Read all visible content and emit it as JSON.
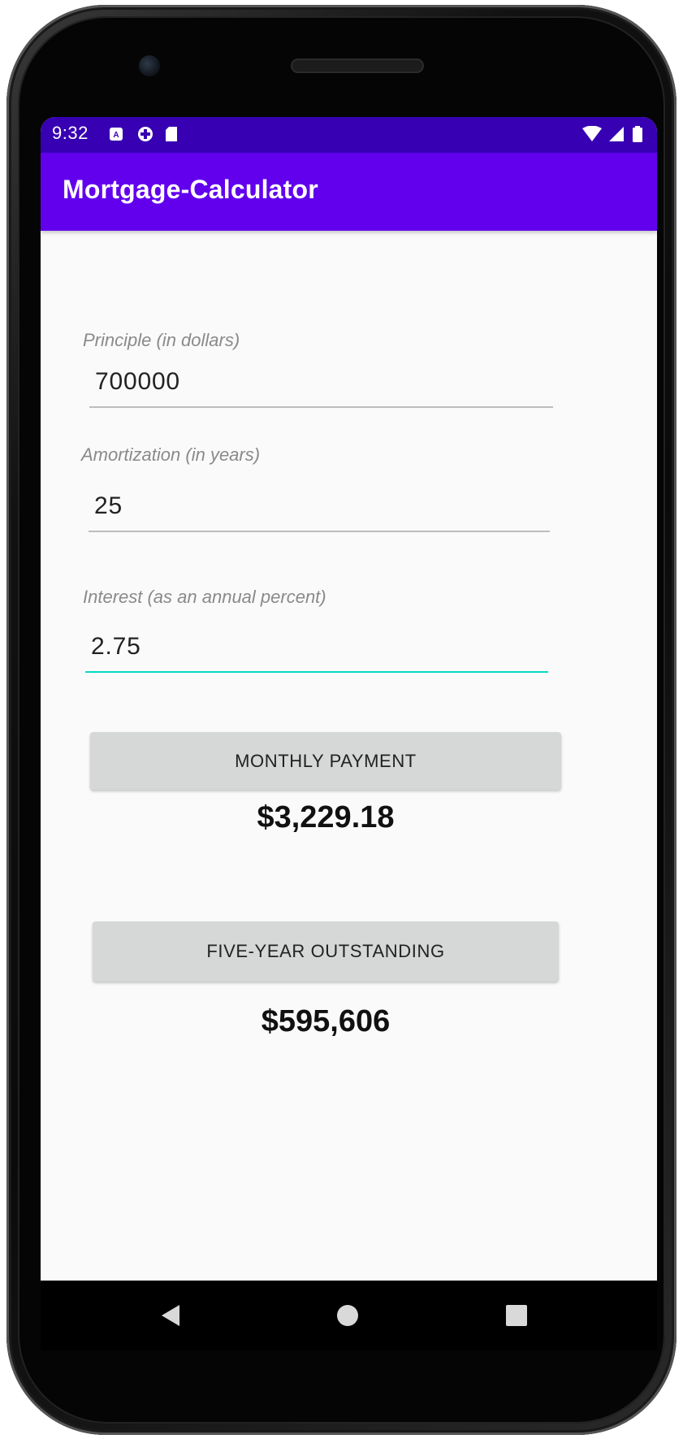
{
  "status_bar": {
    "time": "9:32",
    "left_icons": [
      "notification-a-icon",
      "data-saver-icon",
      "sd-card-icon"
    ],
    "right_icons": [
      "wifi-icon",
      "cell-signal-icon",
      "battery-icon"
    ],
    "background_color": "#3700b3"
  },
  "app_bar": {
    "title": "Mortgage-Calculator",
    "background_color": "#6200ee"
  },
  "form": {
    "principle": {
      "label": "Principle (in dollars)",
      "value": "700000"
    },
    "amortization": {
      "label": "Amortization (in years)",
      "value": "25"
    },
    "interest": {
      "label": "Interest (as an annual percent)",
      "value": "2.75"
    }
  },
  "actions": {
    "monthly_payment_label": "MONTHLY PAYMENT",
    "monthly_payment_result": "$3,229.18",
    "five_year_label": "FIVE-YEAR OUTSTANDING",
    "five_year_result": "$595,606"
  },
  "colors": {
    "accent": "#03dac5",
    "button_bg": "#d6d7d7",
    "screen_bg": "#fafafa"
  },
  "nav_bar": {
    "icons": [
      "back-icon",
      "home-icon",
      "recents-icon"
    ]
  }
}
